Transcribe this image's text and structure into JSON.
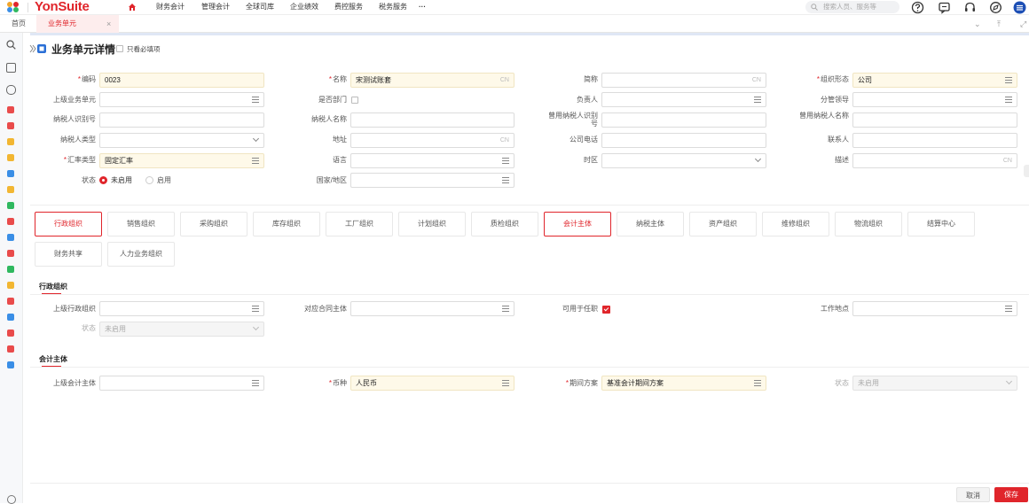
{
  "brand": {
    "name": "YonSuite"
  },
  "topnav": [
    {
      "label": "财务会计"
    },
    {
      "label": "管理会计"
    },
    {
      "label": "全球司库"
    },
    {
      "label": "企业绩效"
    },
    {
      "label": "费控服务"
    },
    {
      "label": "税务服务"
    },
    {
      "label": "···"
    }
  ],
  "search": {
    "placeholder": "搜索人员、服务等"
  },
  "tabs": {
    "home": "首页",
    "current": "业务单元",
    "close": "×"
  },
  "page": {
    "title": "业务单元详情",
    "only_required": "只看必填项"
  },
  "form": {
    "code": {
      "label": "编码",
      "value": "0023"
    },
    "name": {
      "label": "名称",
      "value": "宋测试账套",
      "suffix": "CN"
    },
    "short_name": {
      "label": "简称",
      "value": "",
      "suffix": "CN"
    },
    "org_form": {
      "label": "组织形态",
      "value": "公司"
    },
    "parent_unit": {
      "label": "上级业务单元",
      "value": ""
    },
    "is_dept": {
      "label": "是否部门"
    },
    "manager": {
      "label": "负责人",
      "value": ""
    },
    "leader": {
      "label": "分管领导",
      "value": ""
    },
    "taxpayer_id": {
      "label": "纳税人识别号",
      "value": ""
    },
    "taxpayer_name": {
      "label": "纳税人名称",
      "value": ""
    },
    "former_taxpayer_id": {
      "label": "曾用纳税人识别号",
      "value": ""
    },
    "former_taxpayer_name": {
      "label": "曾用纳税人名称",
      "value": ""
    },
    "taxpayer_type": {
      "label": "纳税人类型",
      "value": ""
    },
    "address": {
      "label": "地址",
      "value": "",
      "suffix": "CN"
    },
    "phone": {
      "label": "公司电话",
      "value": ""
    },
    "contact": {
      "label": "联系人",
      "value": ""
    },
    "rate_type": {
      "label": "汇率类型",
      "value": "固定汇率"
    },
    "language": {
      "label": "语言",
      "value": ""
    },
    "timezone": {
      "label": "时区",
      "value": ""
    },
    "description": {
      "label": "描述",
      "value": "",
      "suffix": "CN"
    },
    "status": {
      "label": "状态",
      "opt_off": "未启用",
      "opt_on": "启用"
    },
    "country": {
      "label": "国家/地区",
      "value": ""
    }
  },
  "org_tabs": [
    {
      "label": "行政组织"
    },
    {
      "label": "销售组织"
    },
    {
      "label": "采购组织"
    },
    {
      "label": "库存组织"
    },
    {
      "label": "工厂组织"
    },
    {
      "label": "计划组织"
    },
    {
      "label": "质检组织"
    },
    {
      "label": "会计主体"
    },
    {
      "label": "纳税主体"
    },
    {
      "label": "资产组织"
    },
    {
      "label": "维修组织"
    },
    {
      "label": "物流组织"
    },
    {
      "label": "结算中心"
    },
    {
      "label": "财务共享"
    },
    {
      "label": "人力业务组织"
    }
  ],
  "admin_section": {
    "title": "行政组织",
    "parent_label": "上级行政组织",
    "contract_label": "对应合同主体",
    "for_post_label": "可用于任职",
    "workplace_label": "工作地点",
    "status_label": "状态",
    "status_value": "未启用"
  },
  "acct_section": {
    "title": "会计主体",
    "parent_label": "上级会计主体",
    "currency_label": "币种",
    "currency_value": "人民币",
    "period_label": "期间方案",
    "period_value": "基准会计期间方案",
    "status_label": "状态",
    "status_value": "未启用"
  },
  "footer": {
    "cancel": "取消",
    "save": "保存"
  },
  "colors": {
    "accent": "#e0252b",
    "required_bg": "#fef9e9"
  }
}
